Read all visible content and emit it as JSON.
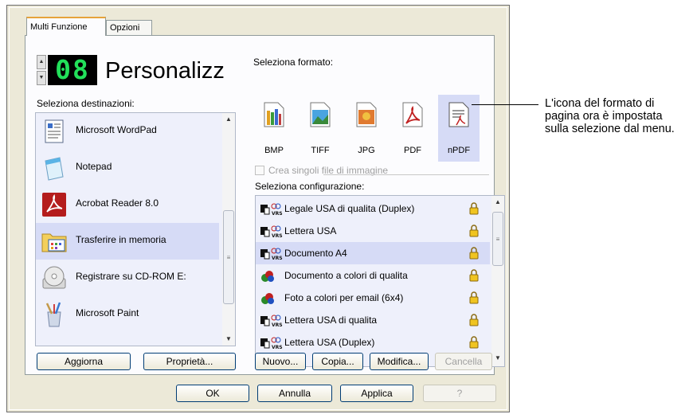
{
  "tabs": [
    "Multi Funzione",
    "Opzioni"
  ],
  "counter": "08",
  "profile_name": "Personalizz",
  "destinations": {
    "label": "Seleziona destinazioni:",
    "items": [
      {
        "label": "Microsoft WordPad",
        "icon": "wordpad-icon"
      },
      {
        "label": "Notepad",
        "icon": "notepad-icon"
      },
      {
        "label": "Acrobat Reader 8.0",
        "icon": "acrobat-icon"
      },
      {
        "label": "Trasferire in memoria",
        "icon": "folder-icon",
        "selected": true
      },
      {
        "label": "Registrare su CD-ROM  E:",
        "icon": "cd-icon"
      },
      {
        "label": "Microsoft Paint",
        "icon": "paint-icon"
      }
    ],
    "buttons": {
      "refresh": "Aggiorna",
      "properties": "Proprietà..."
    }
  },
  "formats": {
    "label": "Seleziona formato:",
    "items": [
      {
        "label": "BMP",
        "icon": "bmp-icon"
      },
      {
        "label": "TIFF",
        "icon": "tiff-icon"
      },
      {
        "label": "JPG",
        "icon": "jpg-icon"
      },
      {
        "label": "PDF",
        "icon": "pdf-icon"
      },
      {
        "label": "nPDF",
        "icon": "npdf-icon",
        "selected": true
      }
    ],
    "single_files_checkbox": "Crea singoli file di immagine"
  },
  "configurations": {
    "label": "Seleziona configurazione:",
    "items": [
      {
        "label": "Legale USA di qualita (Duplex)",
        "icon": "bw-vrs-icon"
      },
      {
        "label": "Lettera USA",
        "icon": "bw-vrs-icon"
      },
      {
        "label": "Documento A4",
        "icon": "bw-vrs-icon",
        "selected": true
      },
      {
        "label": "Documento a colori di qualita",
        "icon": "color-icon"
      },
      {
        "label": "Foto a colori per email (6x4)",
        "icon": "color-icon"
      },
      {
        "label": "Lettera USA di qualita",
        "icon": "bw-vrs-icon"
      },
      {
        "label": "Lettera USA (Duplex)",
        "icon": "bw-vrs-icon"
      }
    ],
    "buttons": {
      "new": "Nuovo...",
      "copy": "Copia...",
      "edit": "Modifica...",
      "delete": "Cancella"
    }
  },
  "dialog_buttons": {
    "ok": "OK",
    "cancel": "Annulla",
    "apply": "Applica",
    "help": "?"
  },
  "callout": "L'icona del formato di pagina ora è impostata sulla selezione dal menu.",
  "colors": {
    "selection": "#d6dbf6",
    "list_bg": "#eef0fb",
    "counter_digits": "#22e05a"
  }
}
